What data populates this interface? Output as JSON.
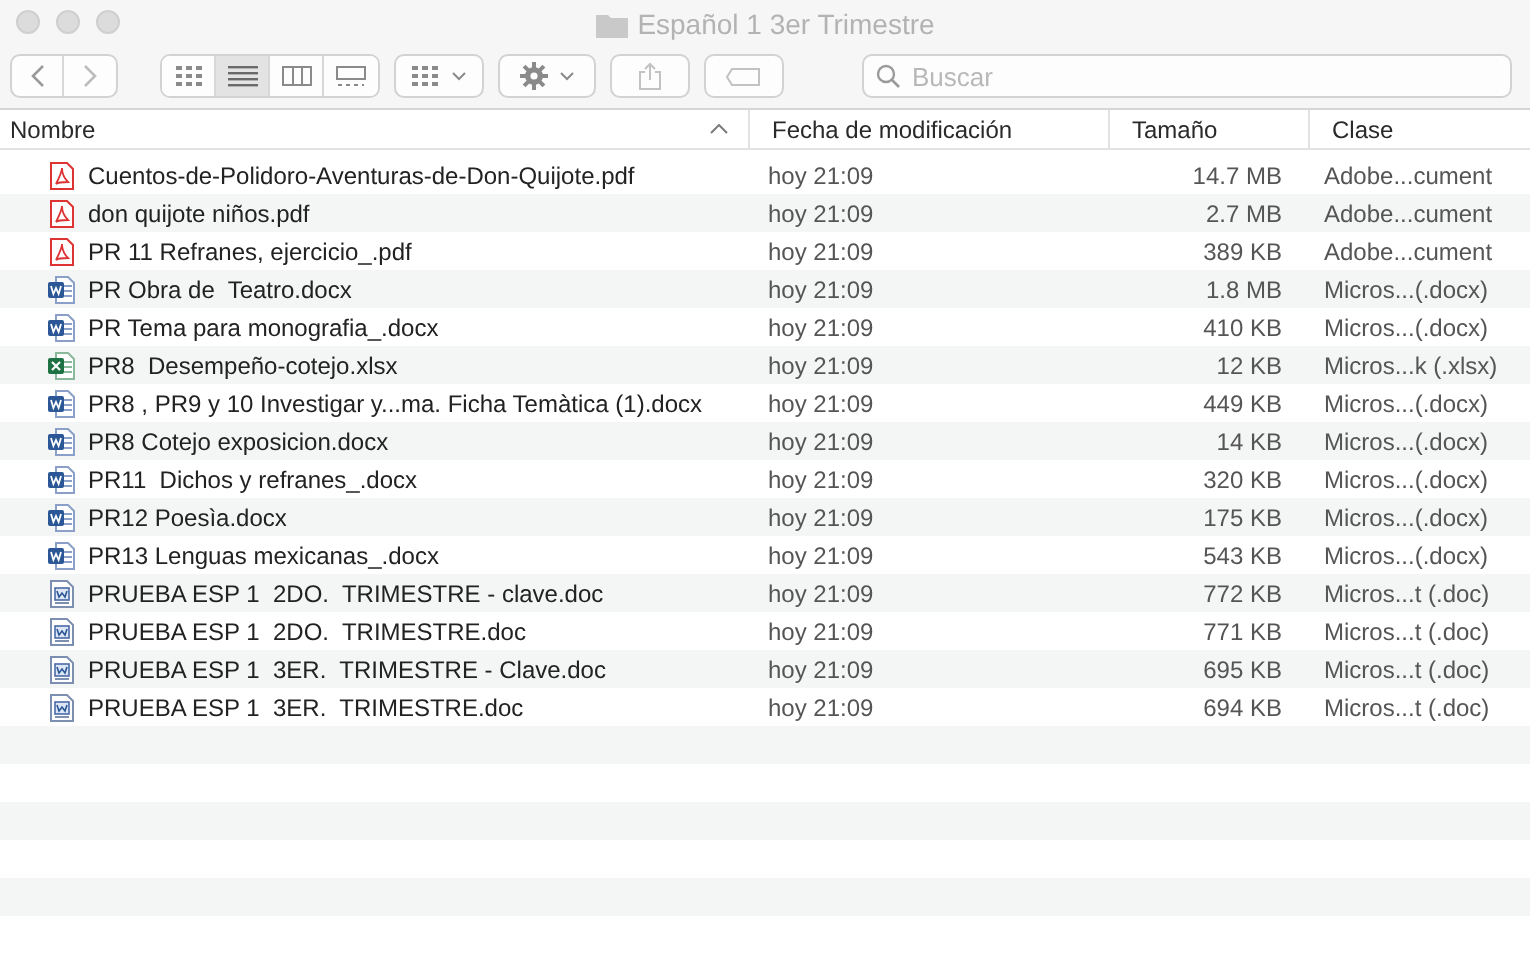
{
  "window": {
    "title": "Español 1 3er Trimestre"
  },
  "views": [
    {
      "selected": false
    },
    {
      "selected": true
    },
    {
      "selected": false
    },
    {
      "selected": false
    }
  ],
  "search": {
    "placeholder": "Buscar"
  },
  "columns": [
    {
      "label": "Nombre",
      "sorted": true
    },
    {
      "label": "Fecha de modificación",
      "sorted": false
    },
    {
      "label": "Tamaño",
      "sorted": false
    },
    {
      "label": "Clase",
      "sorted": false
    }
  ],
  "rows": [
    {
      "kind": "pdf",
      "name": "Cuentos-de-Polidoro-Aventuras-de-Don-Quijote.pdf",
      "date": "hoy 21:09",
      "size": "14.7 MB",
      "type": "Adobe...cument"
    },
    {
      "kind": "pdf",
      "name": "don quijote niños.pdf",
      "date": "hoy 21:09",
      "size": "2.7 MB",
      "type": "Adobe...cument"
    },
    {
      "kind": "pdf",
      "name": "PR 11 Refranes, ejercicio_.pdf",
      "date": "hoy 21:09",
      "size": "389 KB",
      "type": "Adobe...cument"
    },
    {
      "kind": "docx",
      "name": "PR Obra de  Teatro.docx",
      "date": "hoy 21:09",
      "size": "1.8 MB",
      "type": "Micros...(.docx)"
    },
    {
      "kind": "docx",
      "name": "PR Tema para monografia_.docx",
      "date": "hoy 21:09",
      "size": "410 KB",
      "type": "Micros...(.docx)"
    },
    {
      "kind": "xlsx",
      "name": "PR8  Desempeño-cotejo.xlsx",
      "date": "hoy 21:09",
      "size": "12 KB",
      "type": "Micros...k (.xlsx)"
    },
    {
      "kind": "docx",
      "name": "PR8 , PR9 y 10 Investigar y...ma. Ficha Temàtica (1).docx",
      "date": "hoy 21:09",
      "size": "449 KB",
      "type": "Micros...(.docx)"
    },
    {
      "kind": "docx",
      "name": "PR8 Cotejo exposicion.docx",
      "date": "hoy 21:09",
      "size": "14 KB",
      "type": "Micros...(.docx)"
    },
    {
      "kind": "docx",
      "name": "PR11  Dichos y refranes_.docx",
      "date": "hoy 21:09",
      "size": "320 KB",
      "type": "Micros...(.docx)"
    },
    {
      "kind": "docx",
      "name": "PR12 Poesìa.docx",
      "date": "hoy 21:09",
      "size": "175 KB",
      "type": "Micros...(.docx)"
    },
    {
      "kind": "docx",
      "name": "PR13 Lenguas mexicanas_.docx",
      "date": "hoy 21:09",
      "size": "543 KB",
      "type": "Micros...(.docx)"
    },
    {
      "kind": "doc",
      "name": "PRUEBA ESP 1  2DO.  TRIMESTRE - clave.doc",
      "date": "hoy 21:09",
      "size": "772 KB",
      "type": "Micros...t (.doc)"
    },
    {
      "kind": "doc",
      "name": "PRUEBA ESP 1  2DO.  TRIMESTRE.doc",
      "date": "hoy 21:09",
      "size": "771 KB",
      "type": "Micros...t (.doc)"
    },
    {
      "kind": "doc",
      "name": "PRUEBA ESP 1  3ER.  TRIMESTRE - Clave.doc",
      "date": "hoy 21:09",
      "size": "695 KB",
      "type": "Micros...t (.doc)"
    },
    {
      "kind": "doc",
      "name": "PRUEBA ESP 1  3ER.  TRIMESTRE.doc",
      "date": "hoy 21:09",
      "size": "694 KB",
      "type": "Micros...t (.doc)"
    }
  ]
}
